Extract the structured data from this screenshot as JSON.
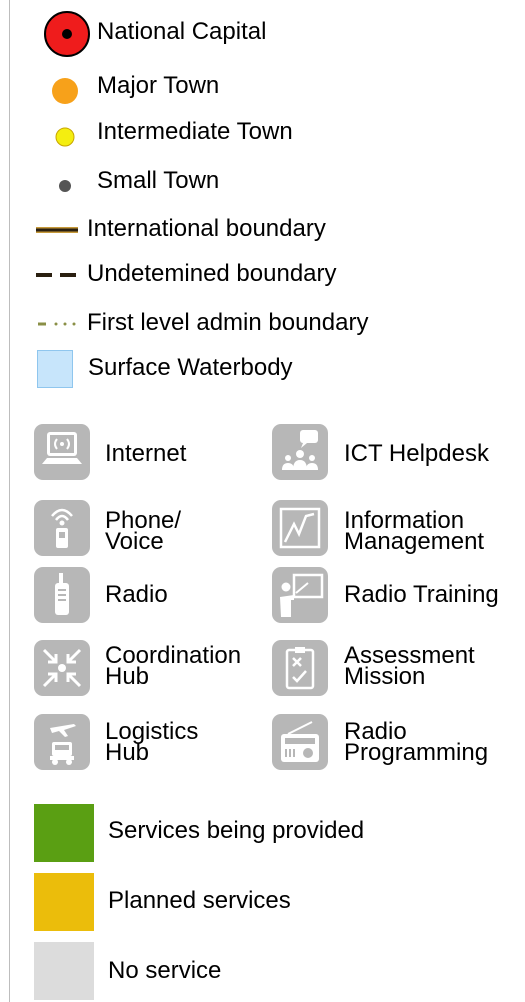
{
  "colors": {
    "capital_fill": "#ef1c1c",
    "major_town": "#f7a11a",
    "intermediate_town": "#f4ee10",
    "small_town": "#555555",
    "international_boundary": "#2a1f10",
    "admin_boundary": "#8a8f46",
    "waterbody": "#c7e5fb",
    "waterbody_border": "#8fc6ee",
    "icon_tile": "#b7b7b7",
    "services_provided": "#5a9f13",
    "planned_services": "#ebbd0b",
    "no_service": "#dcdcdc"
  },
  "legend": {
    "national_capital": "National Capital",
    "major_town": "Major Town",
    "intermediate_town": "Intermediate Town",
    "small_town": "Small Town",
    "international_boundary": "International boundary",
    "undetermined_boundary": "Undetemined boundary",
    "first_level_admin_boundary": "First level admin boundary",
    "surface_waterbody": "Surface Waterbody"
  },
  "services": {
    "internet": "Internet",
    "ict_helpdesk": "ICT Helpdesk",
    "phone_voice": "Phone/\nVoice",
    "information_management": "Information\nManagement",
    "radio": "Radio",
    "radio_training": "Radio Training",
    "coordination_hub": "Coordination\nHub",
    "assessment_mission": "Assessment\nMission",
    "logistics_hub": "Logistics\nHub",
    "radio_programming": "Radio\nProgramming"
  },
  "status": {
    "provided": "Services being provided",
    "planned": "Planned services",
    "none": "No service"
  }
}
